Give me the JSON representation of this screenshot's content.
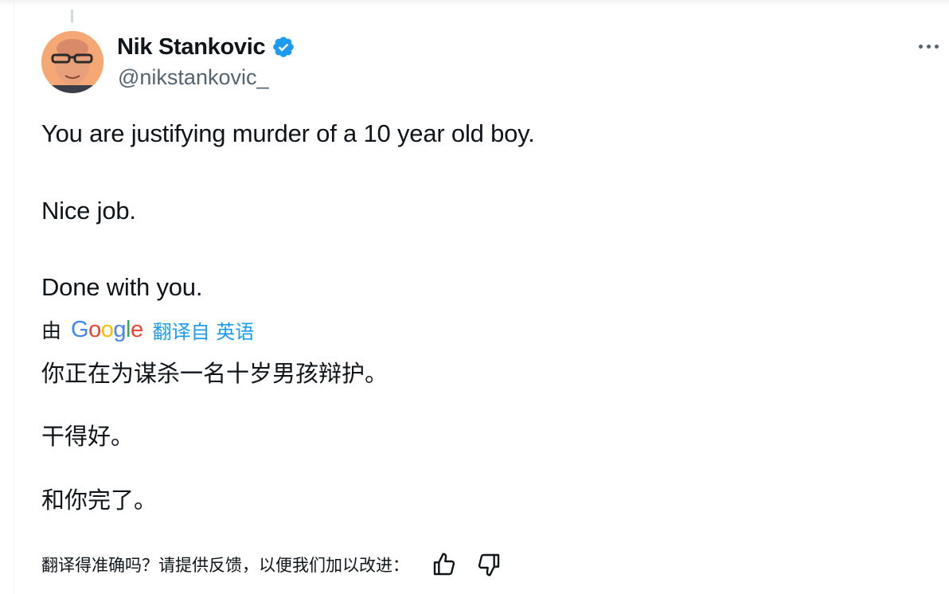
{
  "tweet": {
    "author": {
      "display_name": "Nik Stankovic",
      "handle": "@nikstankovic_",
      "verified": true,
      "avatar_icon": "avatar-photo"
    },
    "text_lines": [
      "You are justifying murder of a 10 year old boy.",
      "Nice job.",
      "Done with you."
    ],
    "translation": {
      "by_label": "由",
      "provider": "Google",
      "link_text": "翻译自 英语",
      "lines": [
        "你正在为谋杀一名十岁男孩辩护。",
        "干得好。",
        "和你完了。"
      ]
    },
    "feedback": {
      "prompt": "翻译得准确吗？请提供反馈，以便我们加以改进：",
      "thumbs_up_icon": "thumbs-up-icon",
      "thumbs_down_icon": "thumbs-down-icon"
    }
  },
  "colors": {
    "text": "#0f1419",
    "secondary": "#536471",
    "link": "#1d9bf0",
    "verified": "#1d9bf0"
  }
}
